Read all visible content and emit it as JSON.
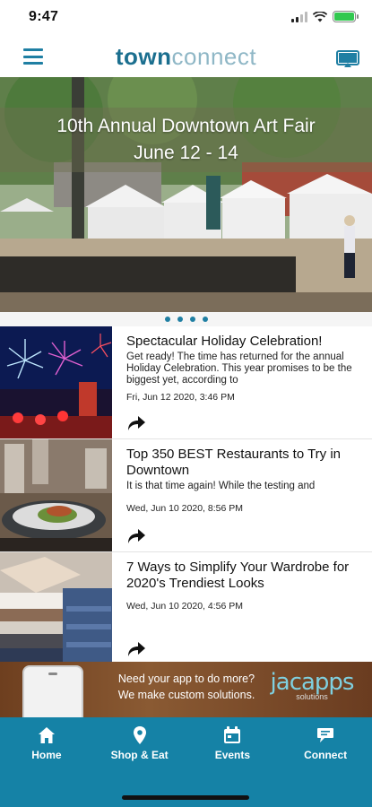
{
  "status_bar": {
    "time": "9:47"
  },
  "header": {
    "logo_part1": "town",
    "logo_part2": "connect"
  },
  "hero": {
    "title_line1": "10th Annual Downtown Art Fair",
    "title_line2": "June 12 - 14",
    "slide_count": 4,
    "active_slide": 0
  },
  "news": [
    {
      "title": "Spectacular Holiday Celebration!",
      "snippet": "Get ready! The time has returned for the annual Holiday Celebration. This year promises to be the biggest yet, according to",
      "date": "Fri, Jun 12 2020, 3:46 PM",
      "thumb": "fireworks"
    },
    {
      "title": "Top 350 BEST Restaurants to Try in Downtown",
      "snippet": "It is that time again! While the testing and",
      "date": "Wed, Jun 10 2020, 8:56 PM",
      "thumb": "restaurant-plate"
    },
    {
      "title": "7 Ways to Simplify Your Wardrobe for 2020's Trendiest Looks",
      "snippet": "",
      "date": "Wed, Jun 10 2020, 4:56 PM",
      "thumb": "folded-clothes"
    }
  ],
  "ad": {
    "line1": "Need your app to do more?",
    "line2": "We make custom solutions.",
    "brand": "jacapps",
    "brand_sub": "solutions"
  },
  "tabs": [
    {
      "label": "Home",
      "icon": "home-icon"
    },
    {
      "label": "Shop & Eat",
      "icon": "map-pin-icon"
    },
    {
      "label": "Events",
      "icon": "calendar-icon"
    },
    {
      "label": "Connect",
      "icon": "chat-bubble-icon"
    }
  ],
  "colors": {
    "brand": "#1582a6",
    "logo_dark": "#1b6f8f",
    "logo_light": "#8fb7c6"
  }
}
